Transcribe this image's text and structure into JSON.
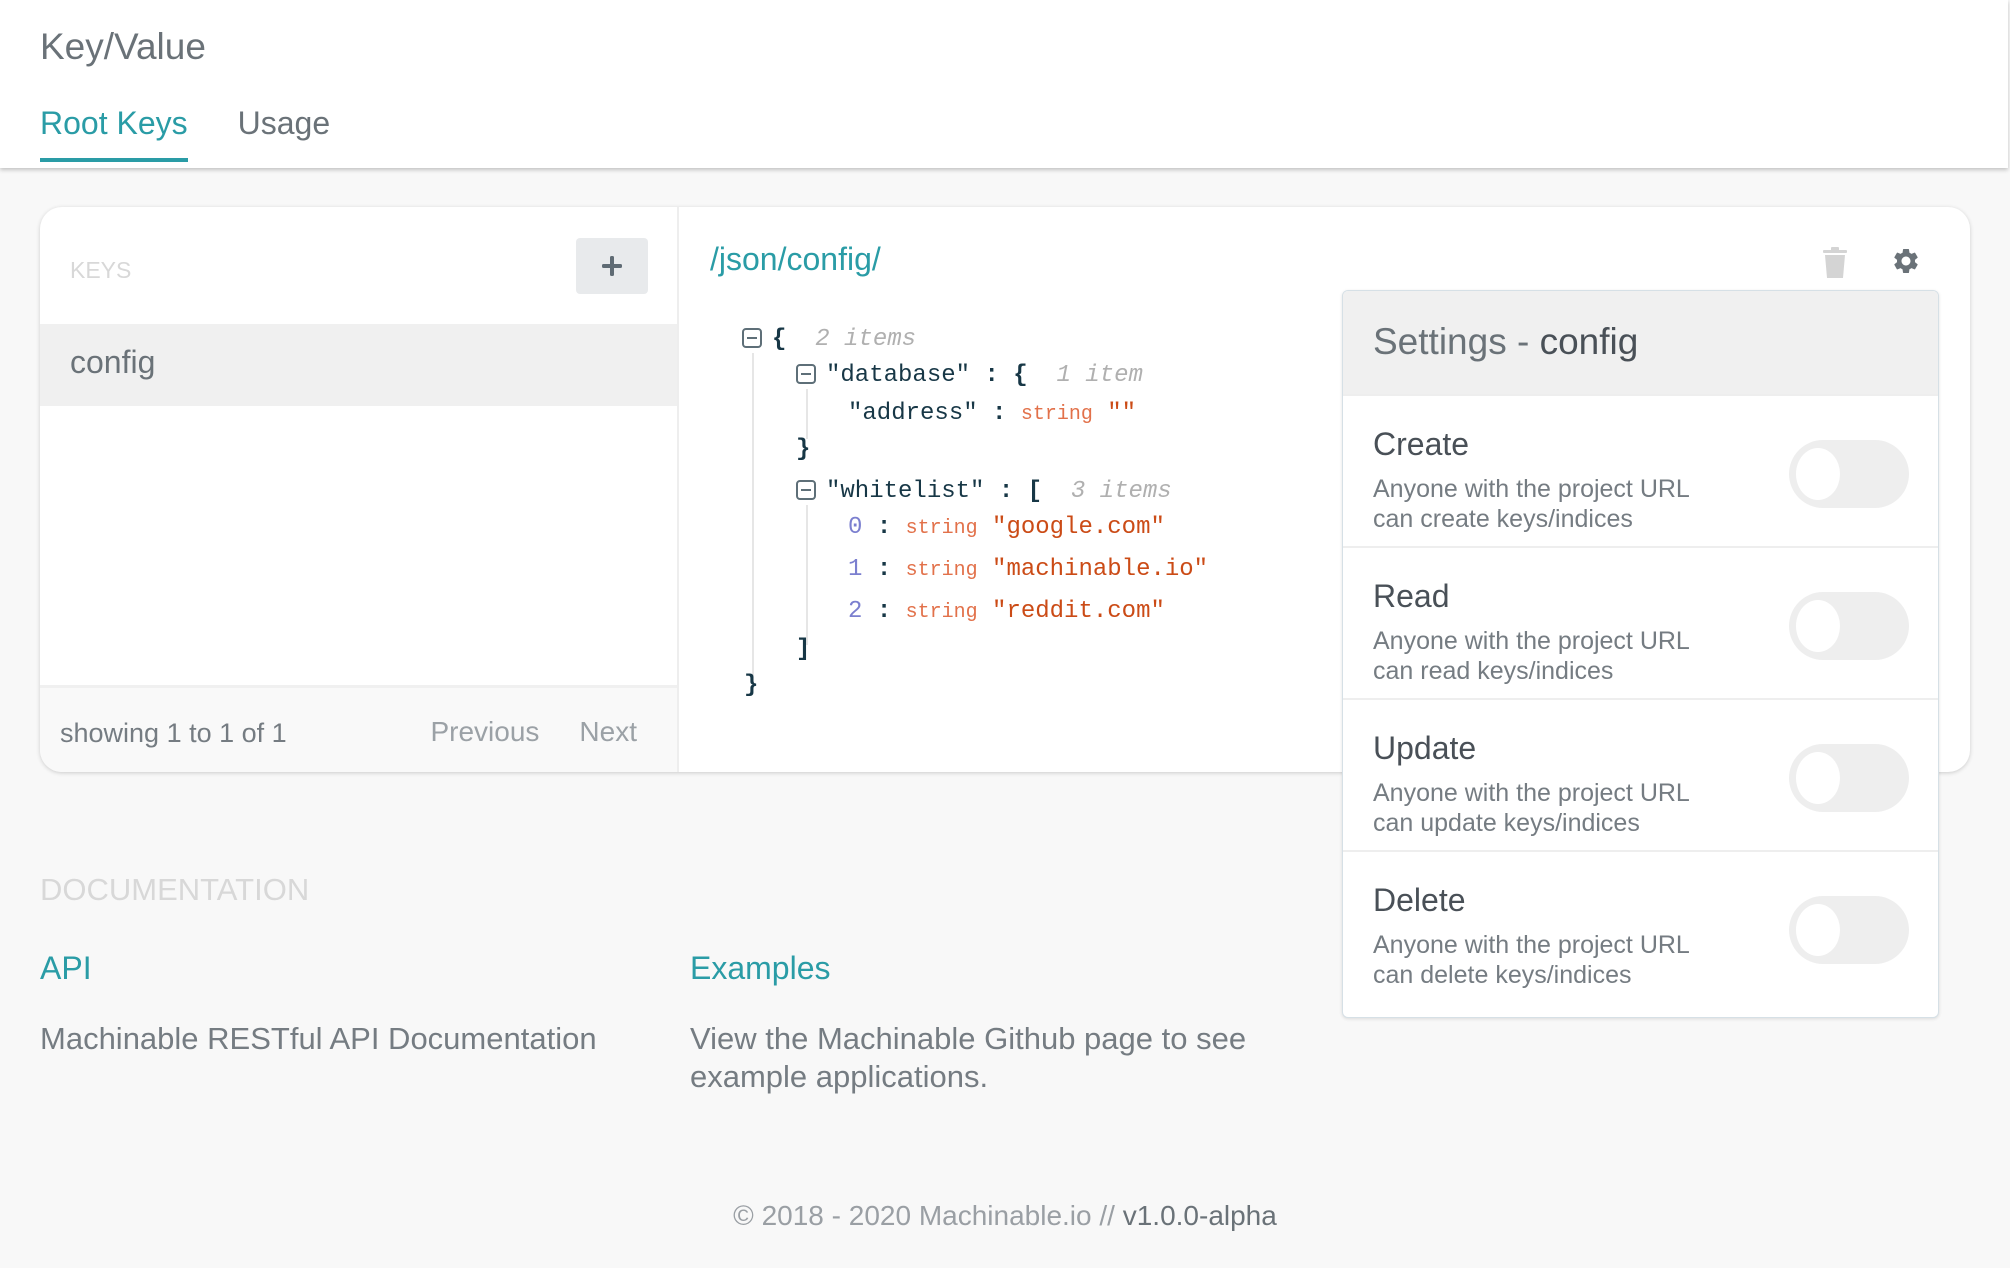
{
  "header": {
    "title": "Key/Value",
    "tabs": [
      {
        "label": "Root Keys",
        "active": true
      },
      {
        "label": "Usage",
        "active": false
      }
    ],
    "accent_color": "#2a9ca6"
  },
  "keys_panel": {
    "label": "KEYS",
    "add_icon": "plus-icon",
    "items": [
      "config"
    ],
    "selected": "config",
    "footer": {
      "showing": "showing 1 to 1 of 1",
      "previous": "Previous",
      "next": "Next"
    }
  },
  "detail": {
    "path": "/json/config/",
    "delete_icon": "trash-icon",
    "settings_icon": "gear-icon",
    "json_tree": {
      "root_meta": "2 items",
      "database_key": "\"database\"",
      "database_meta": "1 item",
      "address_key": "\"address\"",
      "address_type": "string",
      "address_value": "\"\"",
      "whitelist_key": "\"whitelist\"",
      "whitelist_meta": "3 items",
      "whitelist_items": [
        {
          "index": "0",
          "type": "string",
          "value": "\"google.com\""
        },
        {
          "index": "1",
          "type": "string",
          "value": "\"machinable.io\""
        },
        {
          "index": "2",
          "type": "string",
          "value": "\"reddit.com\""
        }
      ]
    }
  },
  "settings": {
    "title": "Settings -",
    "key": "config",
    "permissions": [
      {
        "name": "Create",
        "desc_line1": "Anyone with the project URL",
        "desc_line2": "can create keys/indices",
        "enabled": false
      },
      {
        "name": "Read",
        "desc_line1": "Anyone with the project URL",
        "desc_line2": "can read keys/indices",
        "enabled": false
      },
      {
        "name": "Update",
        "desc_line1": "Anyone with the project URL",
        "desc_line2": "can update keys/indices",
        "enabled": false
      },
      {
        "name": "Delete",
        "desc_line1": "Anyone with the project URL",
        "desc_line2": "can delete keys/indices",
        "enabled": false
      }
    ]
  },
  "documentation": {
    "title": "DOCUMENTATION",
    "links": [
      {
        "label": "API",
        "desc": "Machinable RESTful API Documentation"
      },
      {
        "label": "Examples",
        "desc": "View the Machinable Github page to see example applications."
      }
    ]
  },
  "footer": {
    "copyright": "© 2018 - 2020 Machinable.io // ",
    "version": "v1.0.0-alpha"
  }
}
